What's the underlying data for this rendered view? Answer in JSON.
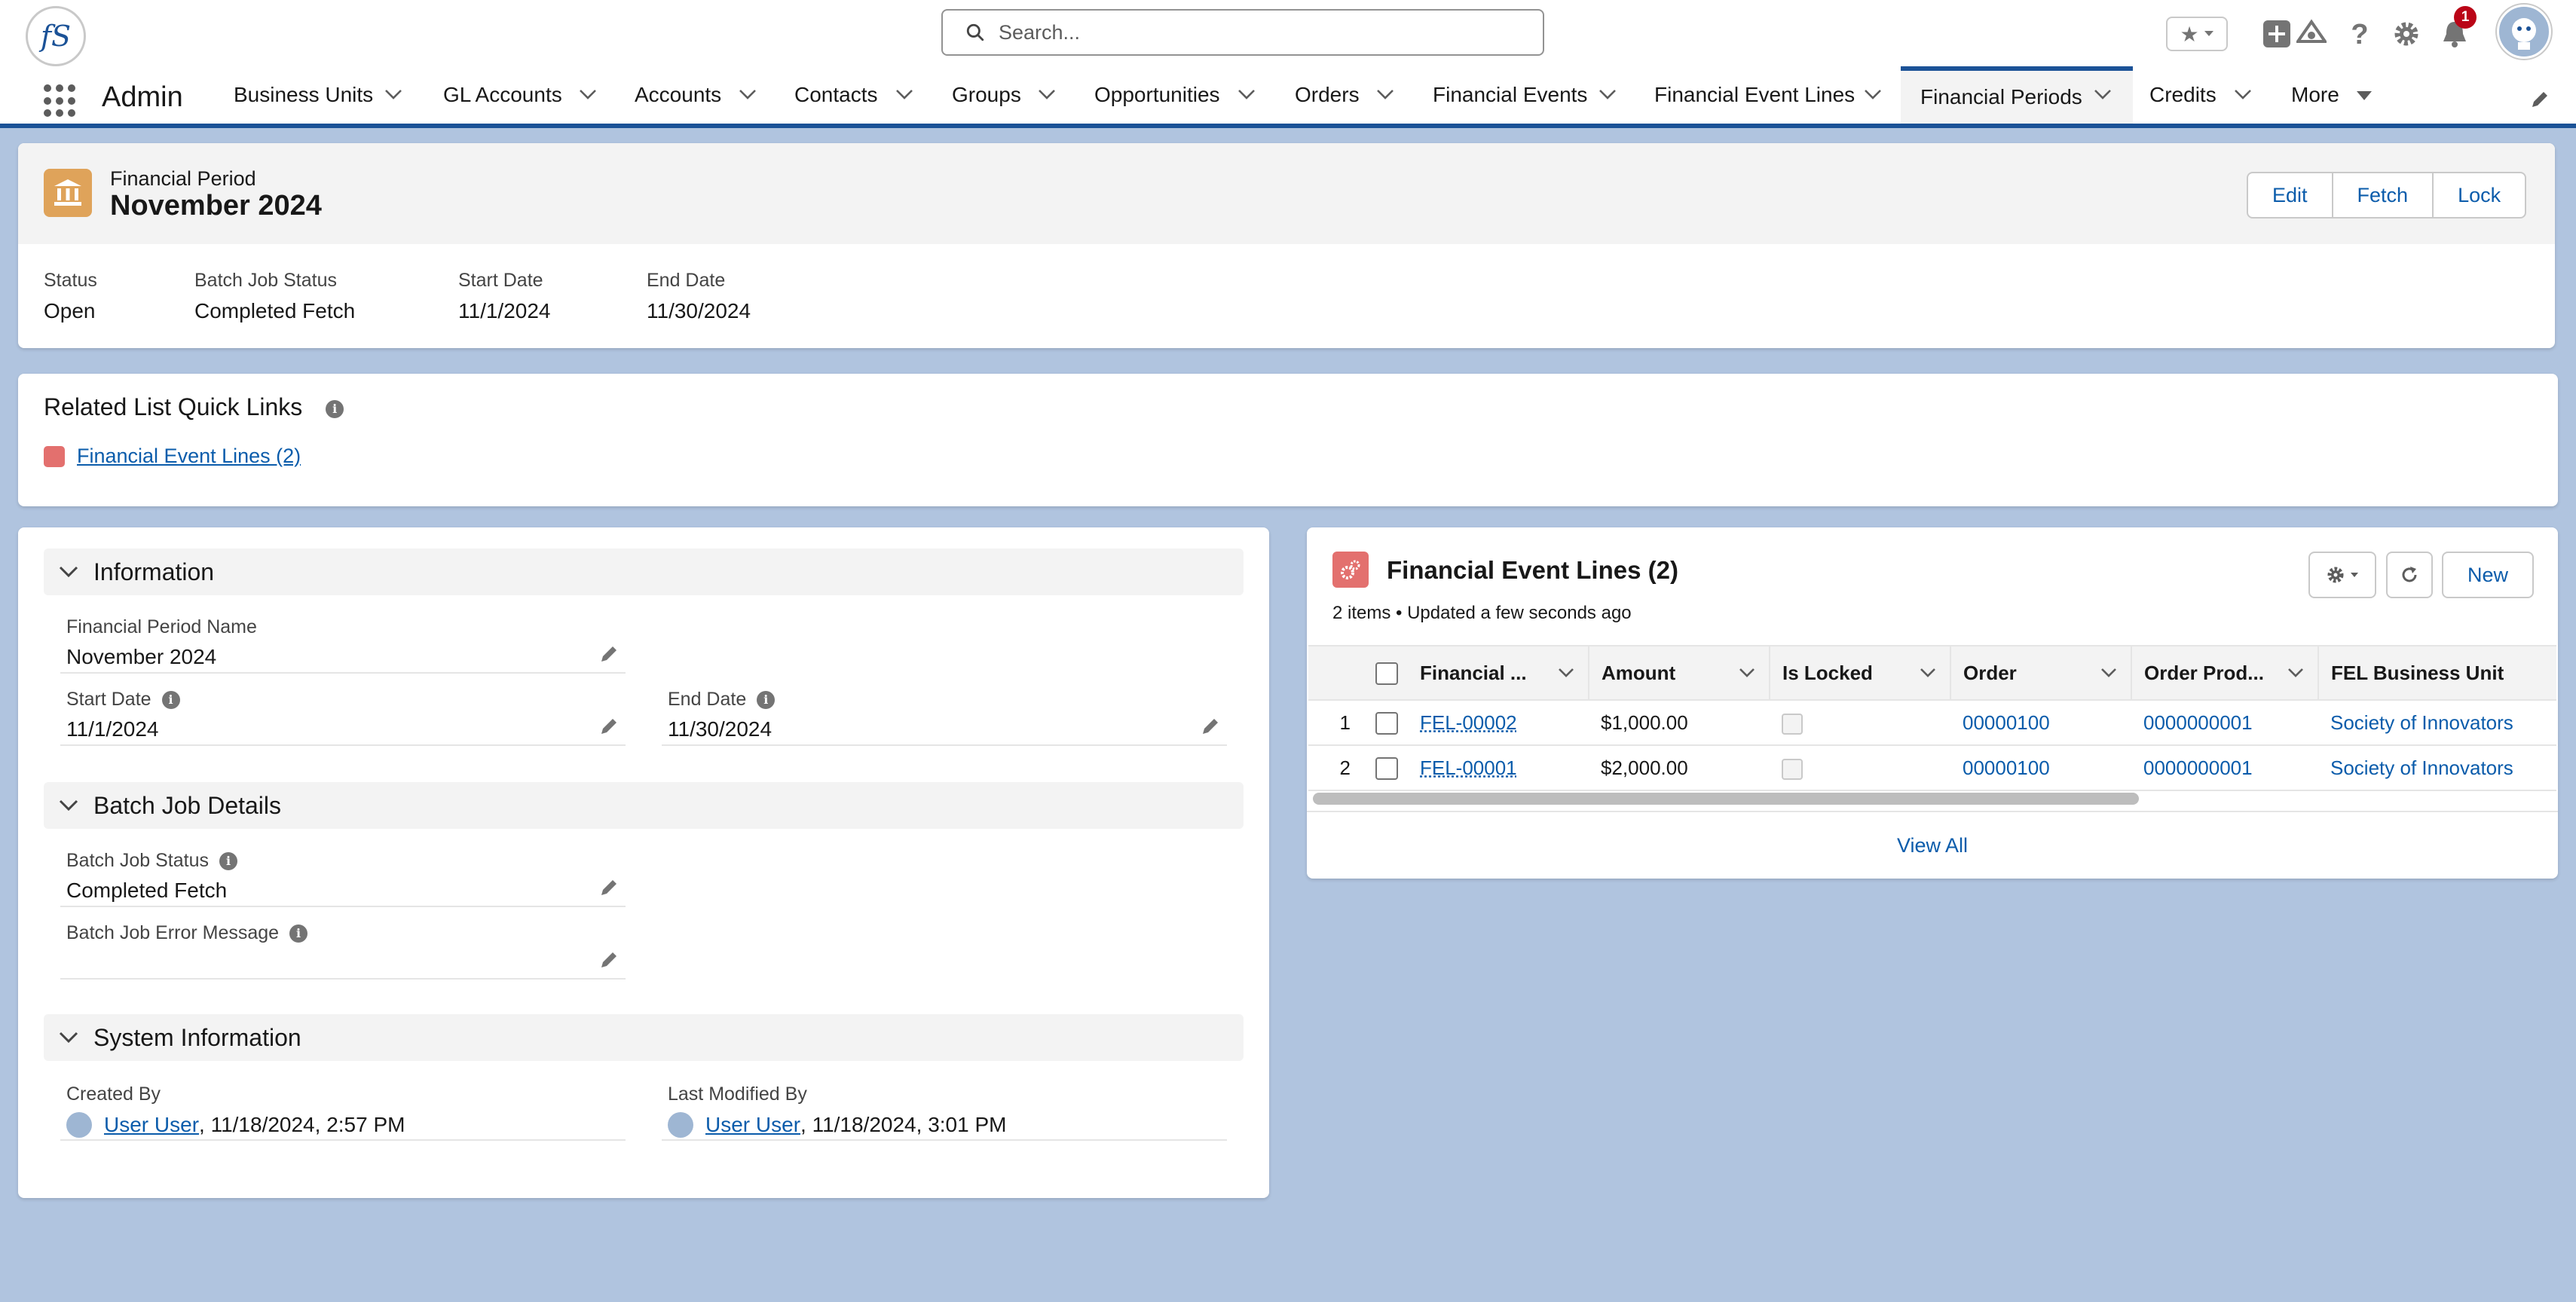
{
  "header": {
    "logo_text": "fS",
    "search_placeholder": "Search...",
    "notification_count": "1"
  },
  "nav": {
    "app_name": "Admin",
    "tabs": [
      {
        "label": "Business Units"
      },
      {
        "label": "GL Accounts"
      },
      {
        "label": "Accounts"
      },
      {
        "label": "Contacts"
      },
      {
        "label": "Groups"
      },
      {
        "label": "Opportunities"
      },
      {
        "label": "Orders"
      },
      {
        "label": "Financial Events"
      },
      {
        "label": "Financial Event Lines"
      },
      {
        "label": "Financial Periods",
        "active": true
      },
      {
        "label": "Credits"
      },
      {
        "label": "More"
      }
    ]
  },
  "record": {
    "object_type": "Financial Period",
    "name": "November 2024",
    "actions": {
      "edit": "Edit",
      "fetch": "Fetch",
      "lock": "Lock"
    },
    "highlights": [
      {
        "label": "Status",
        "value": "Open"
      },
      {
        "label": "Batch Job Status",
        "value": "Completed Fetch"
      },
      {
        "label": "Start Date",
        "value": "11/1/2024"
      },
      {
        "label": "End Date",
        "value": "11/30/2024"
      }
    ]
  },
  "quick_links": {
    "title": "Related List Quick Links",
    "link": "Financial Event Lines (2)"
  },
  "details": {
    "information": {
      "title": "Information",
      "period_name_label": "Financial Period Name",
      "period_name_value": "November 2024",
      "start_label": "Start Date",
      "start_value": "11/1/2024",
      "end_label": "End Date",
      "end_value": "11/30/2024"
    },
    "batch": {
      "title": "Batch Job Details",
      "status_label": "Batch Job Status",
      "status_value": "Completed Fetch",
      "error_label": "Batch Job Error Message",
      "error_value": ""
    },
    "system": {
      "title": "System Information",
      "created_label": "Created By",
      "created_user": "User User",
      "created_time": ", 11/18/2024, 2:57 PM",
      "modified_label": "Last Modified By",
      "modified_user": "User User",
      "modified_time": ", 11/18/2024, 3:01 PM"
    }
  },
  "related_list": {
    "title": "Financial Event Lines (2)",
    "subtitle": "2 items • Updated a few seconds ago",
    "new_label": "New",
    "view_all": "View All",
    "columns": [
      "Financial ...",
      "Amount",
      "Is Locked",
      "Order",
      "Order Prod...",
      "FEL Business Unit"
    ],
    "rows": [
      {
        "num": "1",
        "name": "FEL-00002",
        "amount": "$1,000.00",
        "order": "00000100",
        "order_product": "0000000001",
        "business_unit": "Society of Innovators"
      },
      {
        "num": "2",
        "name": "FEL-00001",
        "amount": "$2,000.00",
        "order": "00000100",
        "order_product": "0000000001",
        "business_unit": "Society of Innovators"
      }
    ]
  },
  "colors": {
    "brand": "#1b5297",
    "link": "#0b5cab",
    "background": "#b0c4df",
    "object_icon": "#dfa35a",
    "related_icon": "#e3706e",
    "badge": "#ba0517"
  }
}
